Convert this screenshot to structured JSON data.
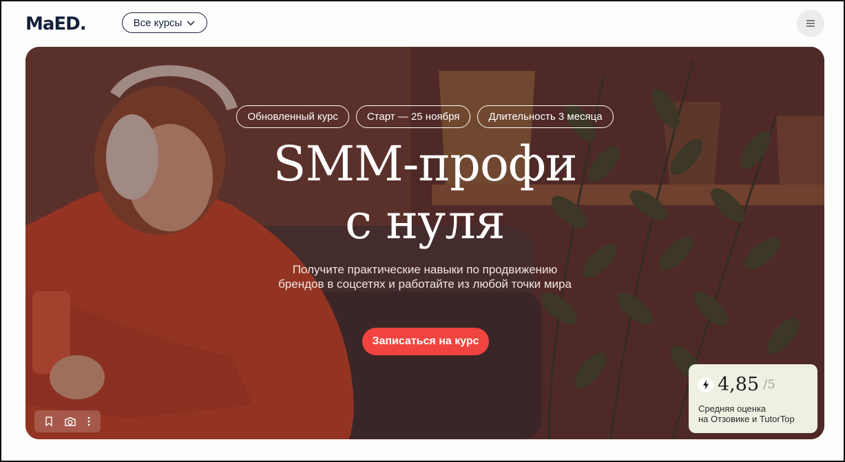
{
  "header": {
    "logo": "MaED.",
    "courses_label": "Все курсы"
  },
  "hero": {
    "tags": [
      "Обновленный курс",
      "Старт — 25 ноября",
      "Длительность 3 месяца"
    ],
    "title_line1": "SMM-профи",
    "title_line2": "с нуля",
    "subtitle_line1": "Получите практические навыки по продвижению",
    "subtitle_line2": "брендов в соцсетях и работайте из любой точки мира",
    "cta_label": "Записаться на курс"
  },
  "rating": {
    "score": "4,85",
    "max": "/5",
    "label_line1": "Средняя оценка",
    "label_line2": "на Отзовике и TutorTop"
  },
  "colors": {
    "brand_navy": "#14203a",
    "cta_red": "#f2443e",
    "rating_bg": "#eef0e2"
  },
  "icons": [
    "chevron-down-icon",
    "menu-icon",
    "bookmark-icon",
    "camera-icon",
    "more-vertical-icon",
    "lightning-icon"
  ]
}
